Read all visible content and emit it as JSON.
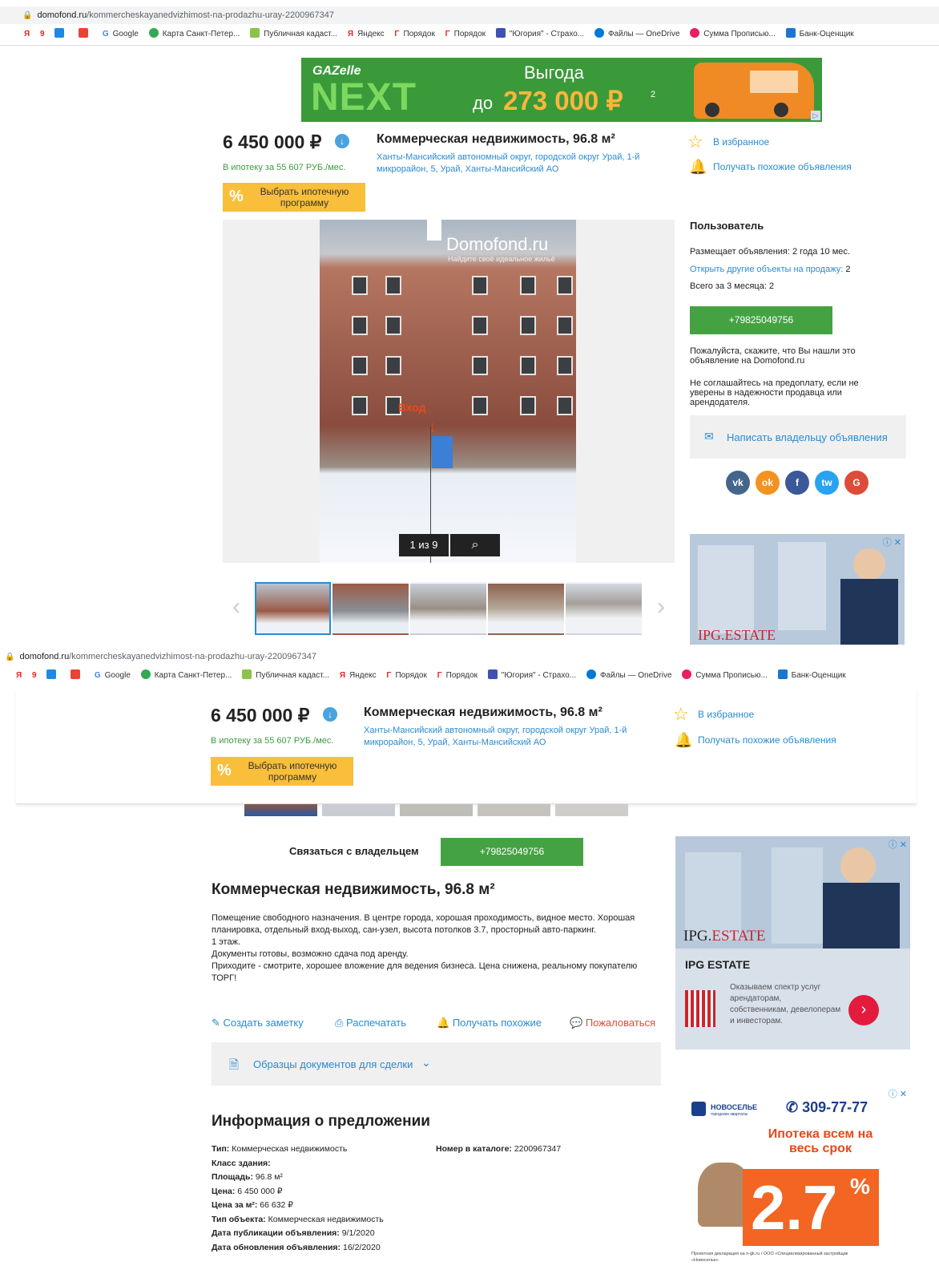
{
  "url": {
    "domain": "domofond.ru",
    "path": "/kommercheskayanedvizhimost-na-prodazhu-uray-2200967347"
  },
  "bookmarks": [
    "Google",
    "Карта Санкт-Петер...",
    "Публичная кадаст...",
    "Яндекс",
    "Порядок",
    "Порядок",
    "\"Югория\" - Страхо...",
    "Файлы — OneDrive",
    "Сумма Прописью...",
    "Банк-Оценщик"
  ],
  "banner": {
    "brand": "GAZelle",
    "model": "NEXT",
    "headline": "Выгода",
    "prefix": "до",
    "amount": "273 000 ₽",
    "sup": "2"
  },
  "listing": {
    "price": "6 450 000 ₽",
    "mortgage": "В ипотеку за 55 607 РУБ./мес.",
    "mortgage_btn": "Выбрать ипотечную программу",
    "title": "Коммерческая недвижимость, 96.8 м²",
    "address": "Ханты-Мансийский автономный округ, городской округ Урай, 1-й микрорайон, 5, Урай, Ханты-Мансийский АО",
    "favorite": "В избранное",
    "subscribe": "Получать похожие объявления"
  },
  "gallery": {
    "watermark": "Domofond.ru",
    "watermark_sub": "Найдите своё идеальное жильё",
    "entrance": "Вход",
    "counter": "1 из 9"
  },
  "seller": {
    "heading": "Пользователь",
    "since": "Размещает объявления: 2 года 10 мес.",
    "others_link": "Открыть другие объекты на продажу:",
    "others_count": "2",
    "recent": "Всего за 3 месяца: 2",
    "phone": "+79825049756",
    "note1": "Пожалуйста, скажите, что Вы нашли это объявление на Domofond.ru",
    "note2": "Не соглашайтесь на предоплату, если не уверены в надежности продавца или арендодателя.",
    "write": "Написать владельцу объявления"
  },
  "social": [
    "vk",
    "ok",
    "f",
    "tw",
    "G"
  ],
  "ad_ipg": {
    "logo": "IPG.",
    "logo2": "ESTATE",
    "title": "IPG ESTATE",
    "text": "Оказываем спектр услуг арендаторам, собственникам, девелоперам и инвесторам."
  },
  "contact": {
    "label": "Связаться с владельцем",
    "phone": "+79825049756"
  },
  "description": {
    "title": "Коммерческая недвижимость, 96.8 м²",
    "lines": [
      "Помещение свободного назначения. В центре города, хорошая проходимость, видное место. Хорошая планировка, отдельный вход-выход, сан-узел, высота потолков 3.7, просторный авто-паркинг.",
      "1 этаж.",
      "Документы готовы, возможно сдача под аренду.",
      "Приходите - смотрите, хорошее вложение для ведения бизнеса. Цена снижена, реальному покупателю ТОРГ!"
    ]
  },
  "actions": [
    "Создать заметку",
    "Распечатать",
    "Получать похожие",
    "Пожаловаться"
  ],
  "docs": "Образцы документов для сделки",
  "info": {
    "heading": "Информация о предложении",
    "rows": [
      {
        "k": "Тип:",
        "v": "Коммерческая недвижимость"
      },
      {
        "k": "Класс здания:",
        "v": ""
      },
      {
        "k": "Площадь:",
        "v": "96.8 м²"
      },
      {
        "k": "Цена:",
        "v": "6 450 000 ₽"
      },
      {
        "k": "Цена за м²:",
        "v": "66 632 ₽"
      },
      {
        "k": "Тип объекта:",
        "v": "Коммерческая недвижимость"
      },
      {
        "k": "Дата публикации объявления:",
        "v": "9/1/2020"
      },
      {
        "k": "Дата обновления объявления:",
        "v": "16/2/2020"
      }
    ],
    "catalog_k": "Номер в каталоге:",
    "catalog_v": "2200967347"
  },
  "ad_novo": {
    "brand": "НОВОСЕЛЬЕ",
    "brand_sub": "городские кварталы",
    "phone": "309-77-77",
    "headline": "Ипотека всем на весь срок",
    "rate": "2.7",
    "pct": "%",
    "foot": "Проектная декларация на n-gk.ru / ООО «Специализированный застройщик «Новоселье»"
  }
}
